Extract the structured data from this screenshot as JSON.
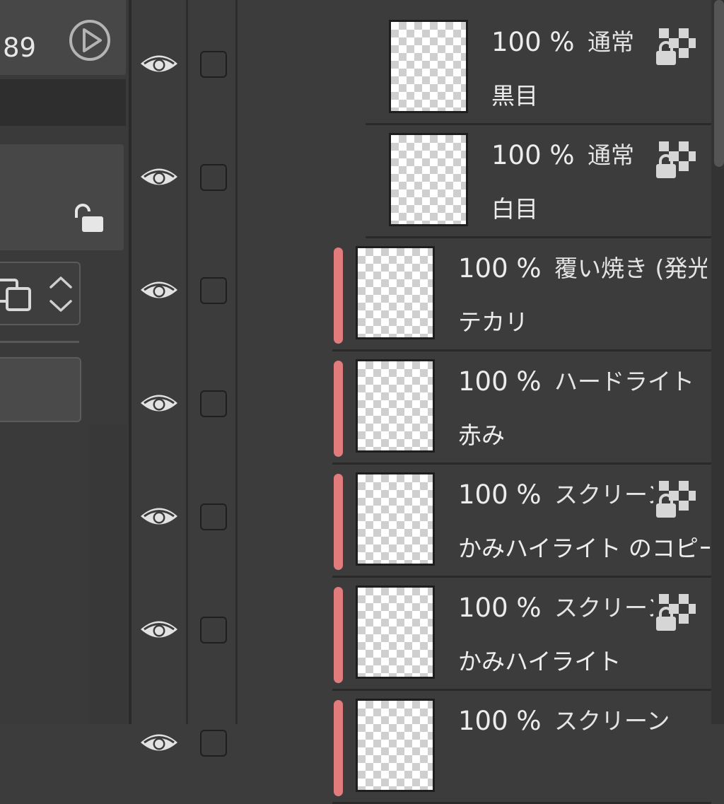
{
  "properties_panel": {
    "value_readout": "89"
  },
  "layers": [
    {
      "opacity": "100 %",
      "blend_mode": "通常",
      "name": "黒目",
      "transparency_locked": true,
      "clipping": false
    },
    {
      "opacity": "100 %",
      "blend_mode": "通常",
      "name": "白目",
      "transparency_locked": true,
      "clipping": false
    },
    {
      "opacity": "100 %",
      "blend_mode": "覆い焼き (発光)",
      "name": "テカリ",
      "transparency_locked": false,
      "clipping": true
    },
    {
      "opacity": "100 %",
      "blend_mode": "ハードライト",
      "name": "赤み",
      "transparency_locked": false,
      "clipping": true
    },
    {
      "opacity": "100 %",
      "blend_mode": "スクリーン",
      "name": "かみハイライト のコピー",
      "transparency_locked": true,
      "clipping": true
    },
    {
      "opacity": "100 %",
      "blend_mode": "スクリーン",
      "name": "かみハイライト",
      "transparency_locked": true,
      "clipping": true
    },
    {
      "opacity": "100 %",
      "blend_mode": "スクリーン",
      "name": "",
      "transparency_locked": false,
      "clipping": true
    }
  ],
  "colors": {
    "clipping_bar": "#e27b7b",
    "panel_bg": "#3c3c3c"
  }
}
